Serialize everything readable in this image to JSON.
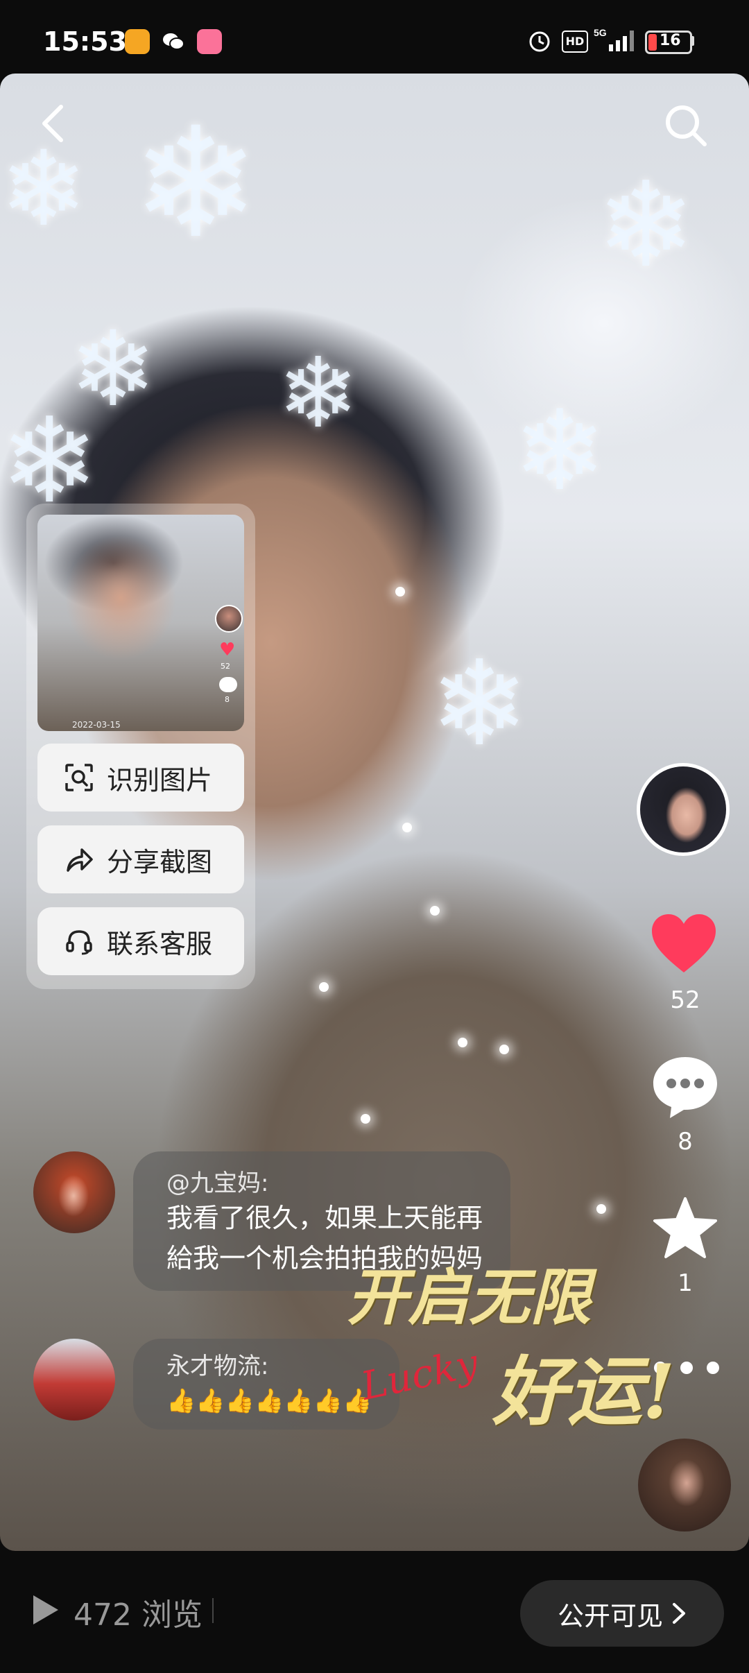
{
  "status_bar": {
    "time": "15:53",
    "apps": [
      "weibo-icon",
      "wechat-icon",
      "bilibili-icon"
    ],
    "right_icons": [
      "alarm-icon",
      "hd-icon",
      "5g-signal-icon"
    ],
    "battery": "16"
  },
  "popup_menu": {
    "items": [
      {
        "label": "识别图片",
        "icon": "scan-icon"
      },
      {
        "label": "分享截图",
        "icon": "share-icon"
      },
      {
        "label": "联系客服",
        "icon": "headset-icon"
      }
    ],
    "thumbnail": {
      "likes": "52",
      "comments": "8",
      "time_partial": "2022-03-15"
    }
  },
  "actions": {
    "likes": "52",
    "comments": "8",
    "favorites": "1"
  },
  "comments": [
    {
      "user": "@九宝妈:",
      "text_line1": "我看了很久，如果上天能再",
      "text_line2": "給我一个机会拍拍我的妈妈"
    },
    {
      "user": "永才物流:",
      "text": "👍👍👍👍👍👍👍"
    }
  ],
  "sticker": {
    "line1": "开启无限",
    "line2": "好运!",
    "script": "Lucky"
  },
  "bottom": {
    "views": "472 浏览",
    "visibility": "公开可见"
  },
  "colors": {
    "like": "#ff3b5c",
    "background": "#0c0c0c",
    "pill": "#2a2a2a"
  }
}
